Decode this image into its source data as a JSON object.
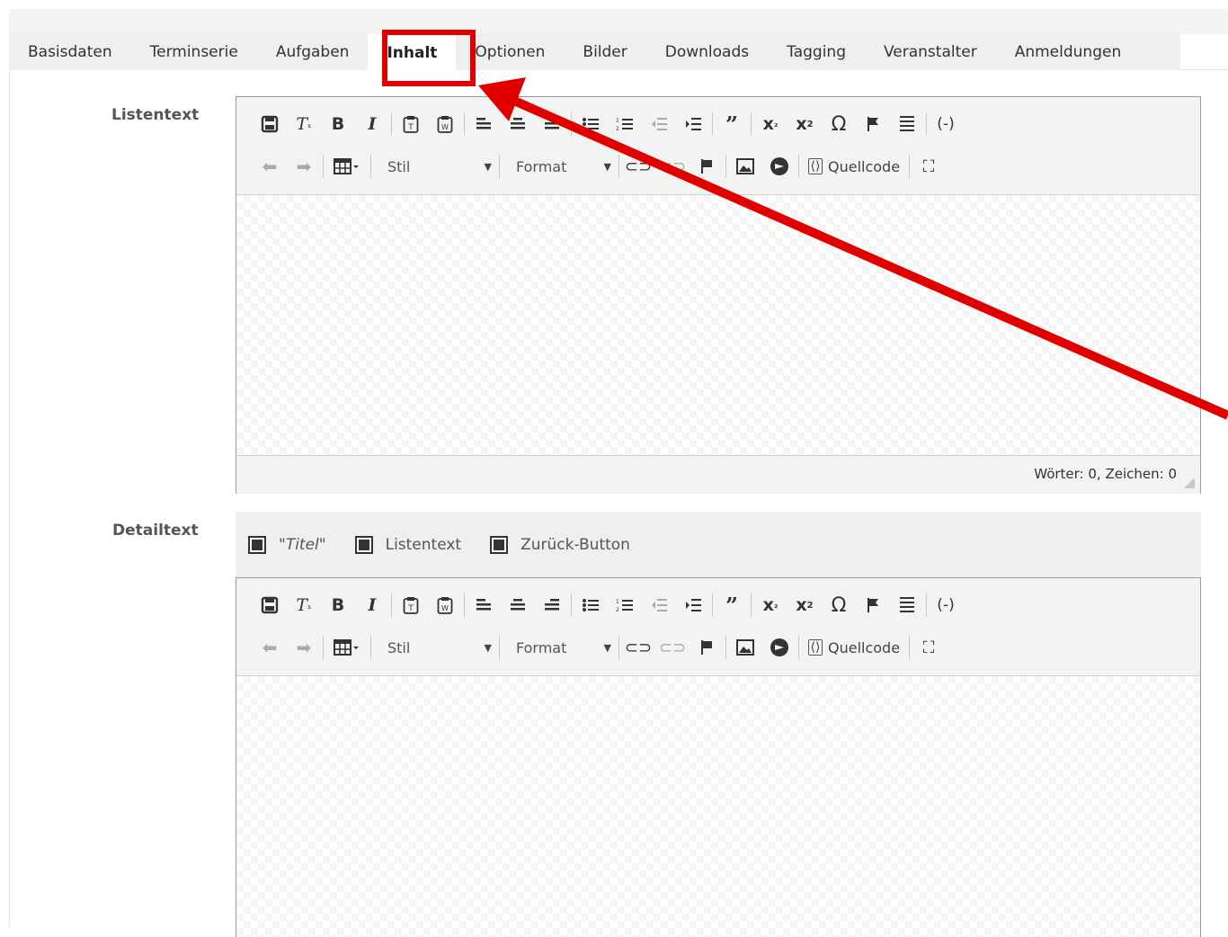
{
  "tabs": [
    {
      "label": "Basisdaten"
    },
    {
      "label": "Terminserie"
    },
    {
      "label": "Aufgaben"
    },
    {
      "label": "Inhalt",
      "active": true
    },
    {
      "label": "Optionen"
    },
    {
      "label": "Bilder"
    },
    {
      "label": "Downloads"
    },
    {
      "label": "Tagging"
    },
    {
      "label": "Veranstalter"
    },
    {
      "label": "Anmeldungen"
    }
  ],
  "listentext": {
    "label": "Listentext",
    "toolbar": {
      "style_label": "Stil",
      "format_label": "Format",
      "source_label": "Quellcode"
    },
    "status": "Wörter: 0, Zeichen: 0"
  },
  "detailtext": {
    "label": "Detailtext",
    "blocks": [
      {
        "label": "\"Titel\"",
        "checked": true
      },
      {
        "label": "Listentext",
        "checked": true
      },
      {
        "label": "Zurück-Button",
        "checked": true
      }
    ],
    "toolbar": {
      "style_label": "Stil",
      "format_label": "Format",
      "source_label": "Quellcode"
    }
  },
  "toolbar_icons": {
    "row1": [
      "save-icon",
      "remove-format-icon",
      "bold-icon",
      "italic-icon",
      "paste-text-icon",
      "paste-word-icon",
      "align-left-icon",
      "align-center-icon",
      "align-right-icon",
      "bulleted-list-icon",
      "numbered-list-icon",
      "outdent-icon",
      "indent-icon",
      "blockquote-icon",
      "subscript-icon",
      "superscript-icon",
      "special-char-icon",
      "anchor-icon",
      "horizontal-line-icon",
      "placeholder-icon"
    ],
    "row2": [
      "undo-icon",
      "redo-icon",
      "table-icon",
      "link-icon",
      "unlink-icon",
      "anchor-flag-icon",
      "image-icon",
      "media-icon",
      "source-icon",
      "maximize-icon"
    ]
  },
  "annotation": {
    "color": "#e00000",
    "target": "Inhalt"
  }
}
